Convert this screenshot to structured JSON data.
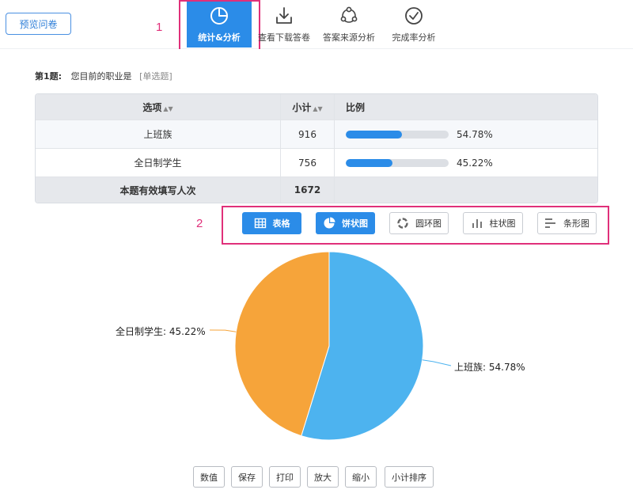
{
  "toolbar": {
    "preview_label": "预览问卷",
    "tools": [
      {
        "label": "统计&分析",
        "icon": "pie-chart-icon",
        "active": true
      },
      {
        "label": "查看下载答卷",
        "icon": "download-icon",
        "active": false
      },
      {
        "label": "答案来源分析",
        "icon": "share-nodes-icon",
        "active": false
      },
      {
        "label": "完成率分析",
        "icon": "check-circle-icon",
        "active": false
      }
    ]
  },
  "annotations": {
    "first": "1",
    "second": "2"
  },
  "question": {
    "number": "第1题:",
    "text": "您目前的职业是",
    "type": "[单选题]"
  },
  "table": {
    "headers": {
      "option": "选项",
      "count": "小计",
      "ratio": "比例"
    },
    "rows": [
      {
        "option": "上班族",
        "count": "916",
        "percent": "54.78%",
        "fraction": 0.5478
      },
      {
        "option": "全日制学生",
        "count": "756",
        "percent": "45.22%",
        "fraction": 0.4522
      }
    ],
    "total": {
      "label": "本题有效填写人次",
      "count": "1672"
    }
  },
  "chart_tabs": [
    {
      "label": "表格",
      "icon": "table-icon",
      "active": true
    },
    {
      "label": "饼状图",
      "icon": "pie-chart-icon",
      "active": true
    },
    {
      "label": "圆环图",
      "icon": "donut-chart-icon",
      "active": false
    },
    {
      "label": "柱状图",
      "icon": "bar-chart-icon",
      "active": false
    },
    {
      "label": "条形图",
      "icon": "horizontal-bar-chart-icon",
      "active": false
    }
  ],
  "chart_data": {
    "type": "pie",
    "series": [
      {
        "name": "上班族",
        "value": 54.78,
        "label": "上班族: 54.78%",
        "color": "#4db3ef"
      },
      {
        "name": "全日制学生",
        "value": 45.22,
        "label": "全日制学生: 45.22%",
        "color": "#f6a43a"
      }
    ],
    "legend": "none"
  },
  "actions": [
    "数值",
    "保存",
    "打印",
    "放大",
    "缩小",
    "小计排序"
  ],
  "colors": {
    "accent": "#2b8ce8",
    "annotation": "#e0307a"
  }
}
